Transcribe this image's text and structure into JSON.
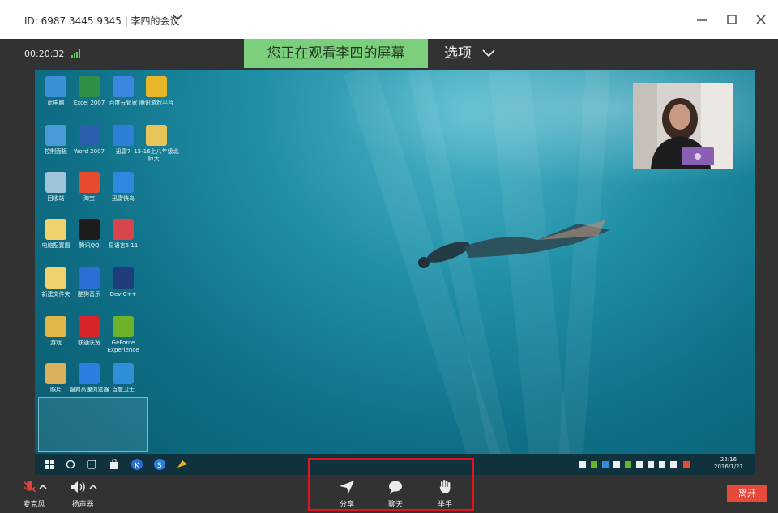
{
  "title_bar": {
    "text": "ID: 6987 3445 9345 | 李四的会议"
  },
  "top_bar": {
    "timer": "00:20:32",
    "watch_banner": "您正在观看李四的屏幕",
    "options_label": "选项"
  },
  "desktop_icons": [
    {
      "label": "此电脑",
      "color": "#3a8fd6"
    },
    {
      "label": "Excel 2007",
      "color": "#2f8f47"
    },
    {
      "label": "百度云管家",
      "color": "#3a86e0"
    },
    {
      "label": "腾讯游戏平台",
      "color": "#e7b628"
    },
    {
      "label": "控制面板",
      "color": "#4a9ad8"
    },
    {
      "label": "Word 2007",
      "color": "#2c5fae"
    },
    {
      "label": "迅雷7",
      "color": "#2f7fd6"
    },
    {
      "label": "15-16上八年级北师大...",
      "color": "#e8c45a"
    },
    {
      "label": "回收站",
      "color": "#9fc4d8"
    },
    {
      "label": "淘宝",
      "color": "#e84c2f"
    },
    {
      "label": "迅雷快鸟",
      "color": "#2d8ae0"
    },
    {
      "label": "电脑配置图",
      "color": "#f0d36a"
    },
    {
      "label": "腾讯QQ",
      "color": "#1c1c1c"
    },
    {
      "label": "易语言5.11",
      "color": "#d8454a"
    },
    {
      "label": "新建文件夹",
      "color": "#f0d36a"
    },
    {
      "label": "酷狗音乐",
      "color": "#2b6fd6"
    },
    {
      "label": "Dev-C++",
      "color": "#1f3d7a"
    },
    {
      "label": "游戏",
      "color": "#e0b84a"
    },
    {
      "label": "联通沃宽",
      "color": "#d8232a"
    },
    {
      "label": "GeForce Experience",
      "color": "#6bb42a"
    },
    {
      "label": "照片",
      "color": "#d9b15a"
    },
    {
      "label": "搜狗高速浏览器",
      "color": "#2a7fe0"
    },
    {
      "label": "百度卫士",
      "color": "#2f8fd8"
    }
  ],
  "taskbar": {
    "time": "22:16",
    "date": "2016/1/21"
  },
  "bottom_bar": {
    "mic_label": "麦克风",
    "speaker_label": "扬声器",
    "share_label": "分享",
    "chat_label": "聊天",
    "raise_hand_label": "举手",
    "leave_label": "离开"
  },
  "colors": {
    "accent_green": "#7ccf7c",
    "leave_red": "#e8493d",
    "highlight_red": "#e0141e",
    "bar_dark": "#323232",
    "mic_muted": "#d9453a"
  }
}
